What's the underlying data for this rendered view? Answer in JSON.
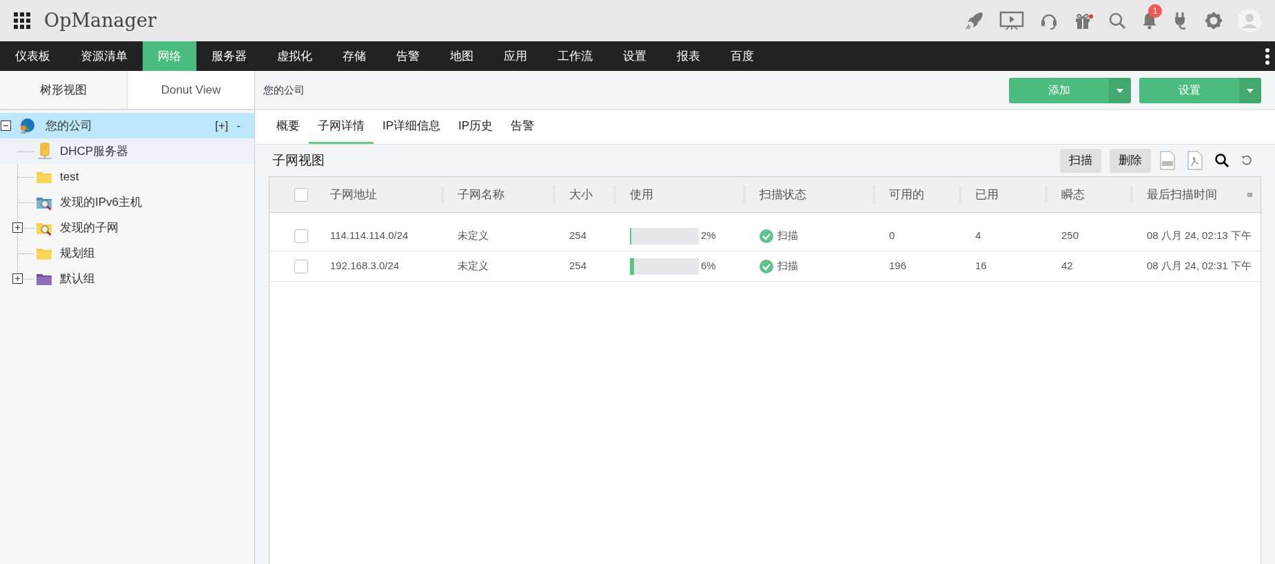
{
  "app": {
    "title": "OpManager"
  },
  "header_icons": [
    {
      "kind": "rocket"
    },
    {
      "kind": "presentation"
    },
    {
      "kind": "headset"
    },
    {
      "kind": "gift"
    },
    {
      "kind": "search"
    },
    {
      "kind": "bell",
      "badge": "1"
    },
    {
      "kind": "plug"
    },
    {
      "kind": "gear"
    },
    {
      "kind": "avatar"
    }
  ],
  "nav": [
    {
      "label": "仪表板",
      "selected": false
    },
    {
      "label": "资源清单",
      "selected": false
    },
    {
      "label": "网络",
      "selected": true
    },
    {
      "label": "服务器",
      "selected": false
    },
    {
      "label": "虚拟化",
      "selected": false
    },
    {
      "label": "存储",
      "selected": false
    },
    {
      "label": "告警",
      "selected": false
    },
    {
      "label": "地图",
      "selected": false
    },
    {
      "label": "应用",
      "selected": false
    },
    {
      "label": "工作流",
      "selected": false
    },
    {
      "label": "设置",
      "selected": false
    },
    {
      "label": "报表",
      "selected": false
    },
    {
      "label": "百度",
      "selected": false
    }
  ],
  "side_tabs": [
    {
      "label": "树形视图",
      "selected": false
    },
    {
      "label": "Donut View",
      "selected": true
    }
  ],
  "tree": {
    "label": "您的公司",
    "kind": "globe",
    "expanded": true,
    "selected": true,
    "actions": [
      "[+]",
      "-"
    ],
    "children": [
      {
        "label": "DHCP服务器",
        "kind": "server",
        "collapsed": false,
        "highlighted": true
      },
      {
        "label": "test",
        "kind": "folder",
        "collapsed": false,
        "highlighted": false
      },
      {
        "label": "发现的IPv6主机",
        "kind": "blue-search-folder",
        "collapsed": false,
        "highlighted": false
      },
      {
        "label": "发现的子网",
        "kind": "search-folder",
        "collapsed": true,
        "highlighted": false
      },
      {
        "label": "规划组",
        "kind": "folder",
        "collapsed": false,
        "highlighted": false
      },
      {
        "label": "默认组",
        "kind": "purple-folder",
        "collapsed": true,
        "highlighted": false
      }
    ]
  },
  "breadcrumb": "您的公司",
  "action_buttons": [
    "添加",
    "设置"
  ],
  "tabs": [
    {
      "label": "概要",
      "selected": false
    },
    {
      "label": "子网详情",
      "selected": true
    },
    {
      "label": "IP详细信息",
      "selected": false
    },
    {
      "label": "IP历史",
      "selected": false
    },
    {
      "label": "告警",
      "selected": false
    }
  ],
  "section": {
    "title": "子网视图",
    "buttons": [
      "扫描",
      "删除"
    ]
  },
  "table": {
    "select_all": {
      "checked": false
    },
    "columns": [
      "子网地址",
      "子网名称",
      "大小",
      "使用",
      "扫描状态",
      "可用的",
      "已用",
      "瞬态",
      "最后扫描时间"
    ],
    "rows": [
      {
        "checked": false,
        "address": "114.114.114.0/24",
        "name": "未定义",
        "size": "254",
        "level": 0.02,
        "usage": "2%",
        "status": "扫描",
        "available": "0",
        "used": "4",
        "transient": "250",
        "last_scan": "08 八月 24, 02:13 下午"
      },
      {
        "checked": false,
        "address": "192.168.3.0/24",
        "name": "未定义",
        "size": "254",
        "level": 0.06,
        "usage": "6%",
        "status": "扫描",
        "available": "196",
        "used": "16",
        "transient": "42",
        "last_scan": "08 八月 24, 02:31 下午"
      }
    ]
  }
}
